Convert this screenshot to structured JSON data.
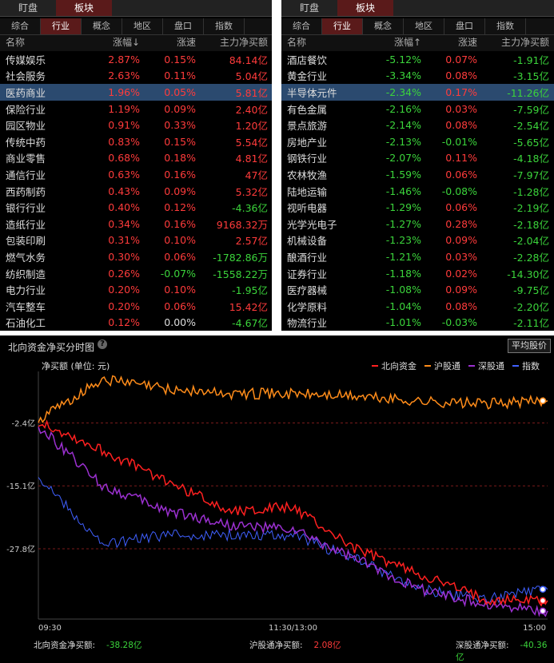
{
  "left_panel": {
    "top_tabs": [
      "盯盘",
      "板块"
    ],
    "active_top_tab": 1,
    "sub_tabs": [
      "综合",
      "行业",
      "概念",
      "地区",
      "盘口",
      "指数"
    ],
    "active_sub_tab": 1,
    "headers": {
      "name": "名称",
      "chg": "涨幅↓",
      "spd": "涨速",
      "amt": "主力净买额"
    },
    "rows": [
      {
        "name": "传媒娱乐",
        "chg": "2.87%",
        "spd": "0.15%",
        "amt": "84.14",
        "unit": "亿",
        "dir_chg": "up",
        "dir_spd": "up",
        "dir_amt": "up"
      },
      {
        "name": "社会服务",
        "chg": "2.63%",
        "spd": "0.11%",
        "amt": "5.04",
        "unit": "亿",
        "dir_chg": "up",
        "dir_spd": "up",
        "dir_amt": "up"
      },
      {
        "name": "医药商业",
        "chg": "1.96%",
        "spd": "0.05%",
        "amt": "5.81",
        "unit": "亿",
        "dir_chg": "up",
        "dir_spd": "up",
        "dir_amt": "up",
        "selected": true
      },
      {
        "name": "保险行业",
        "chg": "1.19%",
        "spd": "0.09%",
        "amt": "2.40",
        "unit": "亿",
        "dir_chg": "up",
        "dir_spd": "up",
        "dir_amt": "up"
      },
      {
        "name": "园区物业",
        "chg": "0.91%",
        "spd": "0.33%",
        "amt": "1.20",
        "unit": "亿",
        "dir_chg": "up",
        "dir_spd": "up",
        "dir_amt": "up"
      },
      {
        "name": "传统中药",
        "chg": "0.83%",
        "spd": "0.15%",
        "amt": "5.54",
        "unit": "亿",
        "dir_chg": "up",
        "dir_spd": "up",
        "dir_amt": "up"
      },
      {
        "name": "商业零售",
        "chg": "0.68%",
        "spd": "0.18%",
        "amt": "4.81",
        "unit": "亿",
        "dir_chg": "up",
        "dir_spd": "up",
        "dir_amt": "up"
      },
      {
        "name": "通信行业",
        "chg": "0.63%",
        "spd": "0.16%",
        "amt": "47",
        "unit": "亿",
        "dir_chg": "up",
        "dir_spd": "up",
        "dir_amt": "up"
      },
      {
        "name": "西药制药",
        "chg": "0.43%",
        "spd": "0.09%",
        "amt": "5.32",
        "unit": "亿",
        "dir_chg": "up",
        "dir_spd": "up",
        "dir_amt": "up"
      },
      {
        "name": "银行行业",
        "chg": "0.40%",
        "spd": "0.12%",
        "amt": "-4.36",
        "unit": "亿",
        "dir_chg": "up",
        "dir_spd": "up",
        "dir_amt": "dn"
      },
      {
        "name": "造纸行业",
        "chg": "0.34%",
        "spd": "0.16%",
        "amt": "9168.32",
        "unit": "万",
        "dir_chg": "up",
        "dir_spd": "up",
        "dir_amt": "up"
      },
      {
        "name": "包装印刷",
        "chg": "0.31%",
        "spd": "0.10%",
        "amt": "2.57",
        "unit": "亿",
        "dir_chg": "up",
        "dir_spd": "up",
        "dir_amt": "up"
      },
      {
        "name": "燃气水务",
        "chg": "0.30%",
        "spd": "0.06%",
        "amt": "-1782.86",
        "unit": "万",
        "dir_chg": "up",
        "dir_spd": "up",
        "dir_amt": "dn"
      },
      {
        "name": "纺织制造",
        "chg": "0.26%",
        "spd": "-0.07%",
        "amt": "-1558.22",
        "unit": "万",
        "dir_chg": "up",
        "dir_spd": "dn",
        "dir_amt": "dn"
      },
      {
        "name": "电力行业",
        "chg": "0.20%",
        "spd": "0.10%",
        "amt": "-1.95",
        "unit": "亿",
        "dir_chg": "up",
        "dir_spd": "up",
        "dir_amt": "dn"
      },
      {
        "name": "汽车整车",
        "chg": "0.20%",
        "spd": "0.06%",
        "amt": "15.42",
        "unit": "亿",
        "dir_chg": "up",
        "dir_spd": "up",
        "dir_amt": "up"
      },
      {
        "name": "石油化工",
        "chg": "0.12%",
        "spd": "0.00%",
        "amt": "-4.67",
        "unit": "亿",
        "dir_chg": "up",
        "dir_spd": "flat",
        "dir_amt": "dn"
      }
    ]
  },
  "right_panel": {
    "top_tabs": [
      "盯盘",
      "板块"
    ],
    "active_top_tab": 1,
    "sub_tabs": [
      "综合",
      "行业",
      "概念",
      "地区",
      "盘口",
      "指数"
    ],
    "active_sub_tab": 1,
    "headers": {
      "name": "名称",
      "chg": "涨幅↑",
      "spd": "涨速",
      "amt": "主力净买额"
    },
    "rows": [
      {
        "name": "酒店餐饮",
        "chg": "-5.12%",
        "spd": "0.07%",
        "amt": "-1.91",
        "unit": "亿",
        "dir_chg": "dn",
        "dir_spd": "up",
        "dir_amt": "dn"
      },
      {
        "name": "黄金行业",
        "chg": "-3.34%",
        "spd": "0.08%",
        "amt": "-3.15",
        "unit": "亿",
        "dir_chg": "dn",
        "dir_spd": "up",
        "dir_amt": "dn"
      },
      {
        "name": "半导体元件",
        "chg": "-2.34%",
        "spd": "0.17%",
        "amt": "-11.26",
        "unit": "亿",
        "dir_chg": "dn",
        "dir_spd": "up",
        "dir_amt": "dn",
        "selected": true
      },
      {
        "name": "有色金属",
        "chg": "-2.16%",
        "spd": "0.03%",
        "amt": "-7.59",
        "unit": "亿",
        "dir_chg": "dn",
        "dir_spd": "up",
        "dir_amt": "dn"
      },
      {
        "name": "景点旅游",
        "chg": "-2.14%",
        "spd": "0.08%",
        "amt": "-2.54",
        "unit": "亿",
        "dir_chg": "dn",
        "dir_spd": "up",
        "dir_amt": "dn"
      },
      {
        "name": "房地产业",
        "chg": "-2.13%",
        "spd": "-0.01%",
        "amt": "-5.65",
        "unit": "亿",
        "dir_chg": "dn",
        "dir_spd": "dn",
        "dir_amt": "dn"
      },
      {
        "name": "钢铁行业",
        "chg": "-2.07%",
        "spd": "0.11%",
        "amt": "-4.18",
        "unit": "亿",
        "dir_chg": "dn",
        "dir_spd": "up",
        "dir_amt": "dn"
      },
      {
        "name": "农林牧渔",
        "chg": "-1.59%",
        "spd": "0.06%",
        "amt": "-7.97",
        "unit": "亿",
        "dir_chg": "dn",
        "dir_spd": "up",
        "dir_amt": "dn"
      },
      {
        "name": "陆地运输",
        "chg": "-1.46%",
        "spd": "-0.08%",
        "amt": "-1.28",
        "unit": "亿",
        "dir_chg": "dn",
        "dir_spd": "dn",
        "dir_amt": "dn"
      },
      {
        "name": "视听电器",
        "chg": "-1.29%",
        "spd": "0.06%",
        "amt": "-2.19",
        "unit": "亿",
        "dir_chg": "dn",
        "dir_spd": "up",
        "dir_amt": "dn"
      },
      {
        "name": "光学光电子",
        "chg": "-1.27%",
        "spd": "0.28%",
        "amt": "-2.18",
        "unit": "亿",
        "dir_chg": "dn",
        "dir_spd": "up",
        "dir_amt": "dn"
      },
      {
        "name": "机械设备",
        "chg": "-1.23%",
        "spd": "0.09%",
        "amt": "-2.04",
        "unit": "亿",
        "dir_chg": "dn",
        "dir_spd": "up",
        "dir_amt": "dn"
      },
      {
        "name": "酿酒行业",
        "chg": "-1.21%",
        "spd": "0.03%",
        "amt": "-2.28",
        "unit": "亿",
        "dir_chg": "dn",
        "dir_spd": "up",
        "dir_amt": "dn"
      },
      {
        "name": "证券行业",
        "chg": "-1.18%",
        "spd": "0.02%",
        "amt": "-14.30",
        "unit": "亿",
        "dir_chg": "dn",
        "dir_spd": "up",
        "dir_amt": "dn"
      },
      {
        "name": "医疗器械",
        "chg": "-1.08%",
        "spd": "0.09%",
        "amt": "-9.75",
        "unit": "亿",
        "dir_chg": "dn",
        "dir_spd": "up",
        "dir_amt": "dn"
      },
      {
        "name": "化学原料",
        "chg": "-1.04%",
        "spd": "0.08%",
        "amt": "-2.20",
        "unit": "亿",
        "dir_chg": "dn",
        "dir_spd": "up",
        "dir_amt": "dn"
      },
      {
        "name": "物流行业",
        "chg": "-1.01%",
        "spd": "-0.03%",
        "amt": "-2.11",
        "unit": "亿",
        "dir_chg": "dn",
        "dir_spd": "dn",
        "dir_amt": "dn"
      }
    ]
  },
  "chart": {
    "title": "北向资金净买分时图",
    "help_glyph": "?",
    "avg_button": "平均股价",
    "unit_label": "净买额 (单位: 元)",
    "legend": [
      {
        "name": "北向资金",
        "color": "#ff2020"
      },
      {
        "name": "沪股通",
        "color": "#ff8c1a"
      },
      {
        "name": "深股通",
        "color": "#9b30d0"
      },
      {
        "name": "指数",
        "color": "#4060ff"
      }
    ],
    "y_ticks": [
      "-2.4亿",
      "-15.1亿",
      "-27.8亿"
    ],
    "x_ticks": [
      "09:30",
      "11:30/13:00",
      "15:00"
    ],
    "footer": [
      {
        "label": "北向资金净买额:",
        "value": "-38.28亿",
        "color": "#3bd43b"
      },
      {
        "label": "沪股通净买额:",
        "value": "2.08亿",
        "color": "#ff3b3b"
      },
      {
        "label": "深股通净买额:",
        "value": "-40.36亿",
        "color": "#3bd43b"
      }
    ]
  },
  "chart_data": {
    "type": "line",
    "x": [
      "09:30",
      "10:00",
      "10:30",
      "11:00",
      "11:30/13:00",
      "13:30",
      "14:00",
      "14:30",
      "15:00"
    ],
    "ylabel": "净买额 (单位: 元)",
    "y_unit": "亿",
    "y_ticks": [
      -2.4,
      -15.1,
      -27.8
    ],
    "series": [
      {
        "name": "北向资金",
        "values": [
          -2.0,
          -8.0,
          -14.0,
          -20.0,
          -19.5,
          -28.0,
          -33.0,
          -38.0,
          -38.28
        ]
      },
      {
        "name": "沪股通",
        "values": [
          -2.0,
          6.5,
          4.5,
          3.5,
          3.5,
          3.0,
          2.0,
          1.5,
          2.08
        ]
      },
      {
        "name": "深股通",
        "values": [
          -3.0,
          -15.0,
          -20.0,
          -23.0,
          -24.0,
          -30.0,
          -36.0,
          -39.0,
          -40.36
        ]
      },
      {
        "name": "指数",
        "values": [
          -13.0,
          -27.0,
          -25.0,
          -25.0,
          -25.0,
          -30.0,
          -36.0,
          -38.0,
          -36.0
        ]
      }
    ]
  }
}
